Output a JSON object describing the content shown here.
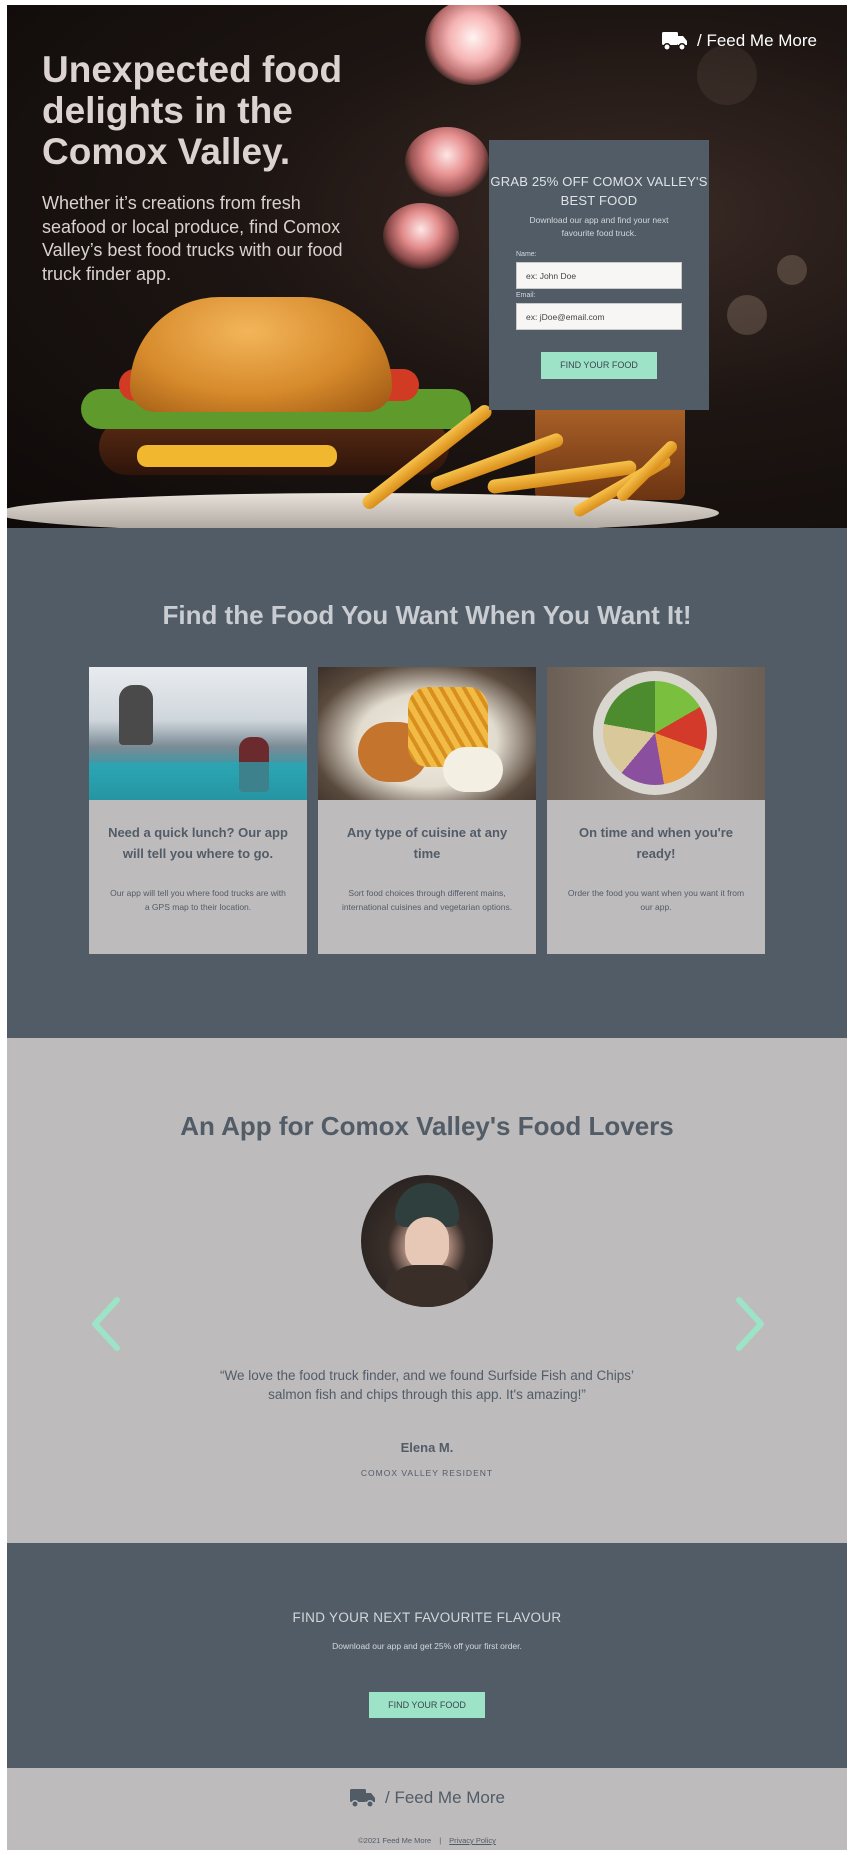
{
  "brand": {
    "name": "/ Feed Me More",
    "icon": "truck-icon"
  },
  "hero": {
    "title": "Unexpected food delights in the Comox Valley.",
    "subtitle": "Whether it’s creations from fresh seafood or local produce, find Comox Valley’s best food trucks with our food truck finder app."
  },
  "signup": {
    "title": "GRAB 25% OFF COMOX VALLEY'S BEST FOOD",
    "subtitle": "Download our app and find your next favourite food truck.",
    "name_label": "Name:",
    "name_placeholder": "ex: John Doe",
    "email_label": "Email:",
    "email_placeholder": "ex: jDoe@email.com",
    "button": "FIND YOUR FOOD"
  },
  "features": {
    "title": "Find the Food You Want When You Want It!",
    "cards": [
      {
        "title": "Need a quick lunch? Our app will tell you where to go.",
        "text": "Our app will tell you where food trucks are with a GPS map to their location."
      },
      {
        "title": "Any type of cuisine at any time",
        "text": "Sort food choices through different mains, international cuisines and vegetarian options."
      },
      {
        "title": "On time and when you're ready!",
        "text": "Order the food you want when you want it from our app."
      }
    ]
  },
  "testimonial": {
    "title": "An App for Comox Valley's Food Lovers",
    "quote": "“We love the food truck finder, and we found Surfside Fish and Chips’ salmon fish and chips through this app. It's amazing!”",
    "author": "Elena M.",
    "role": "COMOX VALLEY RESIDENT"
  },
  "cta": {
    "title": "FIND YOUR NEXT FAVOURITE FLAVOUR",
    "subtitle": "Download our app and get 25% off your first order.",
    "button": "FIND YOUR FOOD"
  },
  "footer": {
    "brand": "/ Feed Me More",
    "copyright": "©2021 Feed Me More",
    "separator": "|",
    "privacy": "Privacy Policy"
  },
  "colors": {
    "slate": "#525c67",
    "mint": "#9de3c7",
    "light_gray": "#bdbbbc"
  }
}
